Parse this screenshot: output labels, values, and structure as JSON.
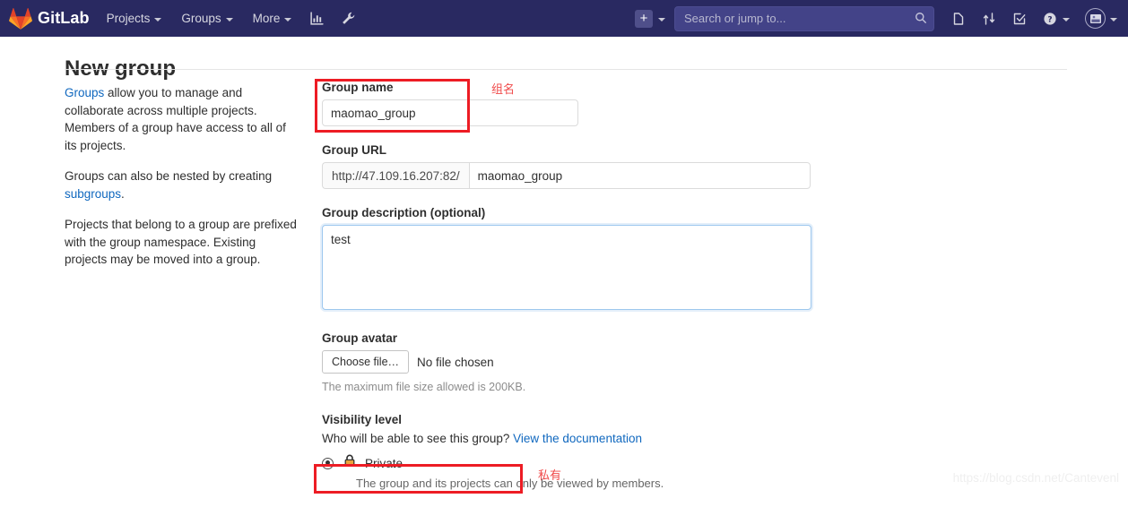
{
  "navbar": {
    "brand": "GitLab",
    "brand_logo_icon": "gitlab-tanuki-logo",
    "items": [
      {
        "label": "Projects",
        "icon": "chevron-down-icon"
      },
      {
        "label": "Groups",
        "icon": "chevron-down-icon"
      },
      {
        "label": "More",
        "icon": "chevron-down-icon"
      }
    ],
    "icons": [
      {
        "name": "analytics-bar-chart-icon"
      },
      {
        "name": "wrench-admin-icon"
      }
    ],
    "create_new": {
      "label": "+",
      "icon": "plus-square-icon",
      "caret": "chevron-down-icon"
    },
    "search": {
      "placeholder": "Search or jump to...",
      "value": "",
      "icon": "search-icon"
    },
    "right_icons": [
      {
        "name": "issues-icon"
      },
      {
        "name": "merge-requests-icon"
      },
      {
        "name": "todos-icon"
      },
      {
        "name": "help-question-icon"
      }
    ],
    "avatar": {
      "icon": "user-avatar-icon",
      "caret": "chevron-down-icon"
    }
  },
  "page": {
    "title": "New group"
  },
  "intro": {
    "p1_link": "Groups",
    "p1_rest": " allow you to manage and collaborate across multiple projects. Members of a group have access to all of its projects.",
    "p2_before": "Groups can also be nested by creating ",
    "p2_link": "subgroups",
    "p2_after": ".",
    "p3": "Projects that belong to a group are prefixed with the group namespace. Existing projects may be moved into a group."
  },
  "form": {
    "group_name": {
      "label": "Group name",
      "value": "maomao_group",
      "placeholder": ""
    },
    "group_url": {
      "label": "Group URL",
      "prefix": "http://47.109.16.207:82/",
      "value": "maomao_group",
      "placeholder": ""
    },
    "group_description": {
      "label": "Group description (optional)",
      "value": "test",
      "placeholder": ""
    },
    "group_avatar": {
      "label": "Group avatar",
      "choose_button": "Choose file…",
      "file_status": "No file chosen",
      "hint": "The maximum file size allowed is 200KB."
    },
    "visibility": {
      "label": "Visibility level",
      "question": "Who will be able to see this group? ",
      "doc_link": "View the documentation",
      "option_label": "Private",
      "option_icon": "lock-icon",
      "option_hint": "The group and its projects can only be viewed by members."
    }
  },
  "annotations": {
    "group_name_cn": "组名",
    "private_cn": "私有",
    "box_color": "#ed1c24",
    "text_color": "#f04a4a"
  },
  "watermark": "https://blog.csdn.net/Cantevenl"
}
